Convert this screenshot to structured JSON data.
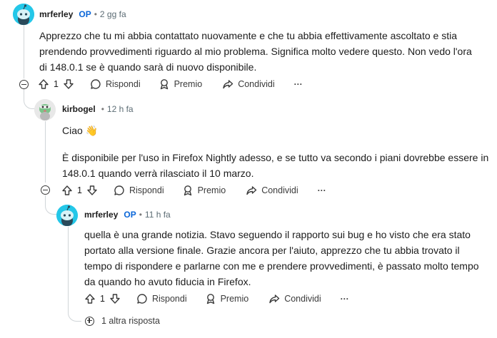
{
  "comments": [
    {
      "author": "mrferley",
      "badge": "OP",
      "time": "2 gg fa",
      "body": [
        "Apprezzo che tu mi abbia contattato nuovamente e che tu abbia effettivamente ascoltato e stia",
        "prendendo provvedimenti riguardo al mio problema. Significa molto vedere questo. Non vedo l'ora",
        "di 148.0.1 se è quando sarà di nuovo disponibile."
      ],
      "score": "1",
      "reply_label": "Rispondi",
      "award_label": "Premio",
      "share_label": "Condividi",
      "more_label": "···"
    },
    {
      "author": "kirbogel",
      "time": "12 h fa",
      "greeting": "Ciao",
      "greeting_emoji": "👋",
      "body": [
        "È disponibile per l'uso in Firefox Nightly adesso, e se tutto va secondo i piani dovrebbe essere in",
        "148.0.1 quando verrà rilasciato il 10 marzo."
      ],
      "score": "1",
      "reply_label": "Rispondi",
      "award_label": "Premio",
      "share_label": "Condividi",
      "more_label": "···"
    },
    {
      "author": "mrferley",
      "badge": "OP",
      "time": "11 h fa",
      "body": [
        "quella è una grande notizia. Stavo seguendo il rapporto sui bug e ho visto che era stato",
        "portato alla versione finale. Grazie ancora per l'aiuto, apprezzo che tu abbia trovato il",
        "tempo di rispondere e parlarne con me e prendere provvedimenti, è passato molto tempo",
        "da quando ho avuto fiducia in Firefox."
      ],
      "score": "1",
      "reply_label": "Rispondi",
      "award_label": "Premio",
      "share_label": "Condividi",
      "more_label": "···"
    }
  ],
  "more_replies_label": "1 altra risposta",
  "colors": {
    "op_blue": "#0a66d8",
    "avatar_cyan": "#24c7e8",
    "thread_line": "#d0d5d8"
  },
  "icons": [
    "snoo-avatar-icon",
    "kirby-avatar-icon",
    "upvote-icon",
    "downvote-icon",
    "comment-icon",
    "award-icon",
    "share-icon",
    "collapse-icon",
    "expand-plus-icon"
  ]
}
